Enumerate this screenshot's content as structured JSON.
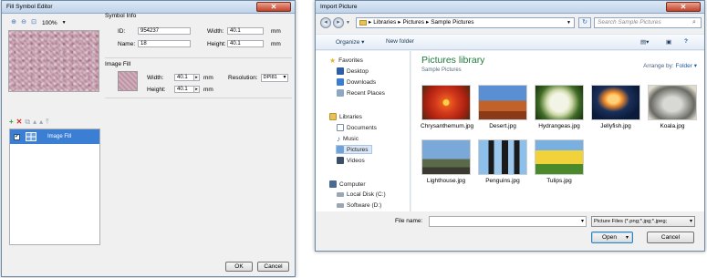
{
  "fill_symbol_editor": {
    "title": "Fill Symbol Editor",
    "close_glyph": "✕",
    "zoom": {
      "zoom_in_icon": "zoom-in-icon",
      "zoom_out_icon": "zoom-out-icon",
      "fit_icon": "fit-icon",
      "value": "100%"
    },
    "symbol_info": {
      "title": "Symbol Info",
      "id_label": "ID:",
      "id_value": "954237",
      "name_label": "Name:",
      "name_value": "18",
      "width_label": "Width:",
      "width_value": "40.1",
      "width_unit": "mm",
      "height_label": "Height:",
      "height_value": "40.1",
      "height_unit": "mm"
    },
    "image_fill": {
      "title": "Image Fill",
      "width_label": "Width:",
      "width_value": "40.1",
      "width_unit": "mm",
      "height_label": "Height:",
      "height_value": "40.1",
      "height_unit": "mm",
      "resolution_label": "Resolution:",
      "resolution_value": "DPI81"
    },
    "layers": {
      "toolbar": [
        "add-icon",
        "delete-icon",
        "copy-icon",
        "move-up-icon",
        "move-down-icon",
        "move-top-icon"
      ],
      "items": [
        {
          "label": "Image Fill",
          "checked": true
        }
      ]
    },
    "ok_label": "OK",
    "cancel_label": "Cancel"
  },
  "import_picture": {
    "title": "Import Picture",
    "close_glyph": "✕",
    "breadcrumb": [
      "Libraries",
      "Pictures",
      "Sample Pictures"
    ],
    "search_placeholder": "Search Sample Pictures",
    "organize_label": "Organize ▾",
    "new_folder_label": "New folder",
    "nav": {
      "favorites": "Favorites",
      "desktop": "Desktop",
      "downloads": "Downloads",
      "recent": "Recent Places",
      "libraries": "Libraries",
      "documents": "Documents",
      "music": "Music",
      "pictures": "Pictures",
      "videos": "Videos",
      "computer": "Computer",
      "local_disk": "Local Disk (C:)",
      "software": "Software (D:)"
    },
    "library_title": "Pictures library",
    "library_subtitle": "Sample Pictures",
    "arrange_label": "Arrange by:",
    "arrange_value": "Folder ▾",
    "files": [
      {
        "name": "Chrysanthemum.jpg"
      },
      {
        "name": "Desert.jpg"
      },
      {
        "name": "Hydrangeas.jpg"
      },
      {
        "name": "Jellyfish.jpg"
      },
      {
        "name": "Koala.jpg"
      },
      {
        "name": "Lighthouse.jpg"
      },
      {
        "name": "Penguins.jpg"
      },
      {
        "name": "Tulips.jpg"
      }
    ],
    "file_name_label": "File name:",
    "file_name_value": "",
    "file_type_value": "Picture Files (*.png;*.jpg;*.jpeg;",
    "open_label": "Open",
    "cancel_label": "Cancel"
  },
  "colors": {
    "accent_blue": "#3b7fd4",
    "library_green": "#1e7a3a",
    "close_red": "#c24026"
  }
}
